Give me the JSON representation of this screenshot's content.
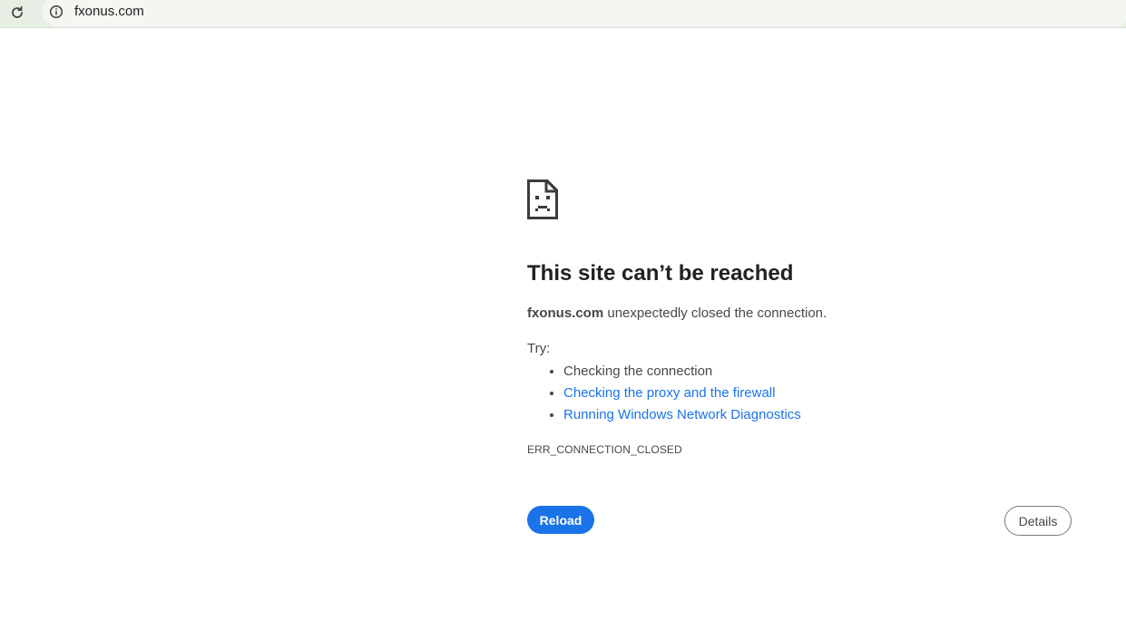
{
  "browser": {
    "reload_icon": "reload-icon",
    "site_info_icon": "info-icon",
    "url": "fxonus.com"
  },
  "error_page": {
    "icon": "sad-document-icon",
    "title": "This site can’t be reached",
    "host": "fxonus.com",
    "message": " unexpectedly closed the connection.",
    "try_label": "Try:",
    "suggestions": [
      "Checking the connection",
      "Checking the proxy and the firewall",
      "Running Windows Network Diagnostics"
    ],
    "error_code": "ERR_CONNECTION_CLOSED",
    "reload_label": "Reload",
    "details_label": "Details",
    "accent_color": "#1a73e8"
  }
}
